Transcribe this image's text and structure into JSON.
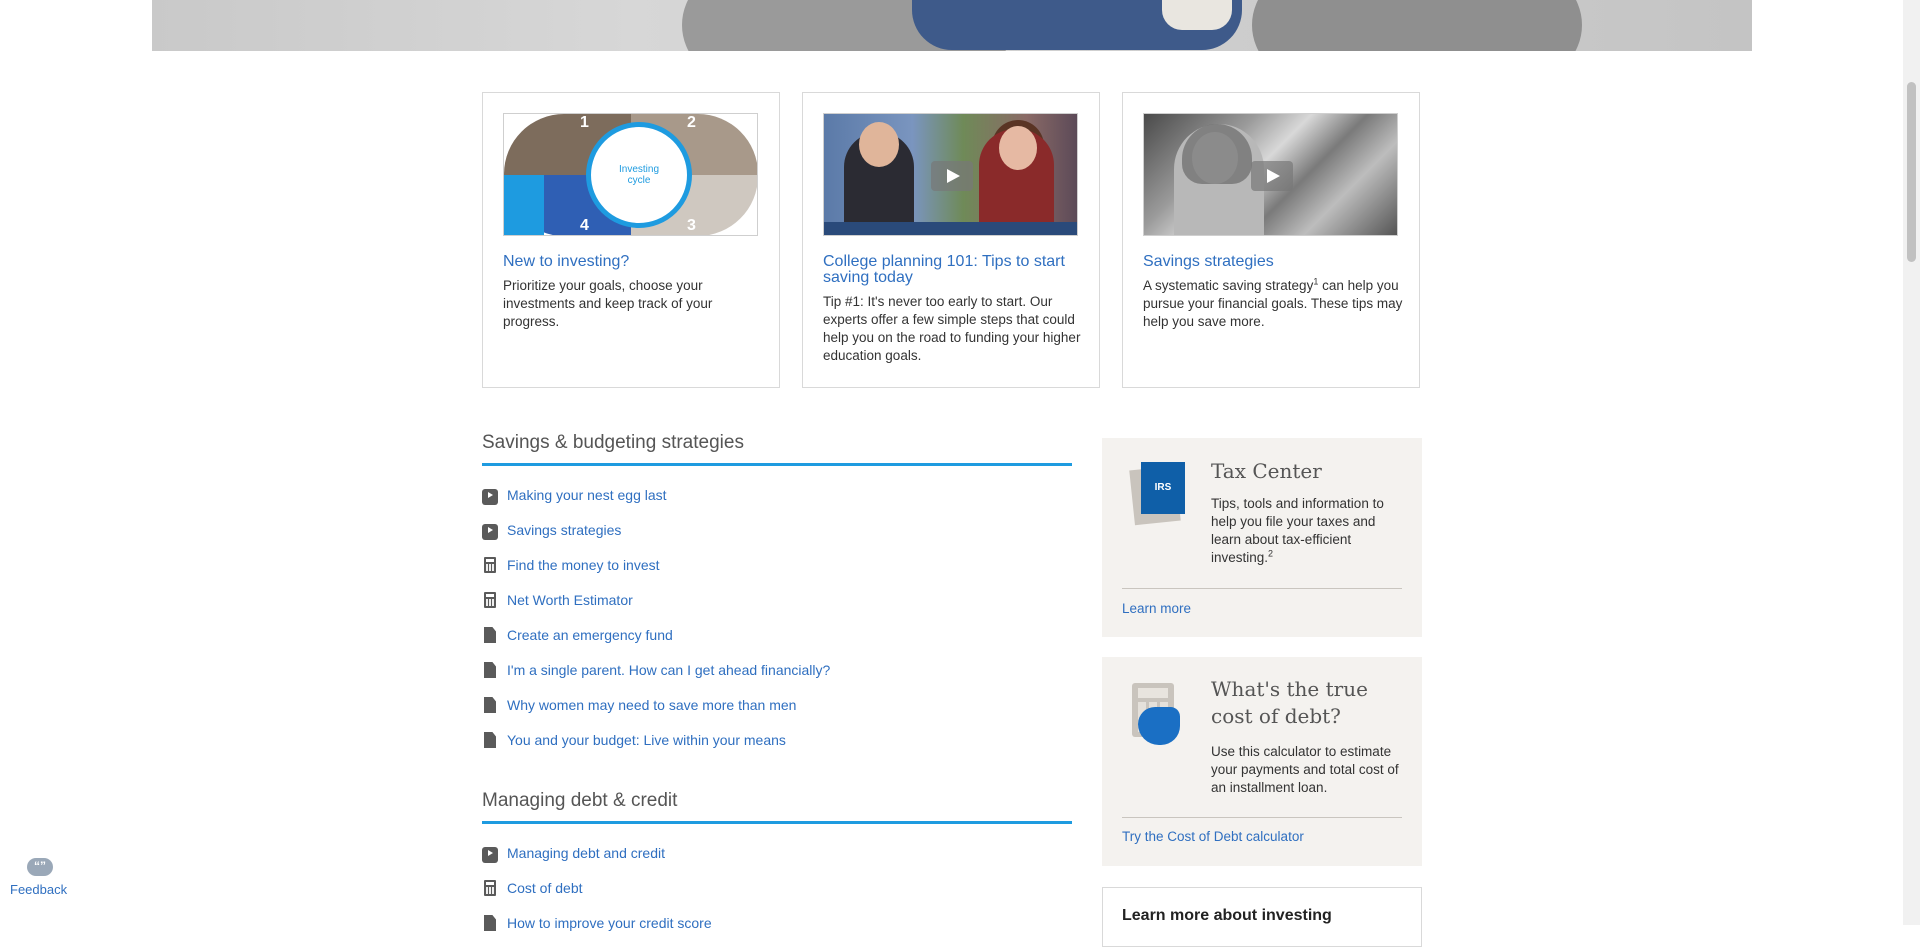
{
  "cards": [
    {
      "title": "New to investing?",
      "description": "Prioritize your goals, choose your investments and keep track of your progress.",
      "thumb_text": "Investing cycle",
      "thumb_numbers": [
        "1",
        "2",
        "3",
        "4"
      ]
    },
    {
      "title": "College planning 101: Tips to start saving today",
      "description": "Tip #1: It's never too early to start. Our experts offer a few simple steps that could help you on the road to funding your higher education goals."
    },
    {
      "title": "Savings strategies",
      "description_before": "A systematic saving strategy",
      "description_sup": "1",
      "description_after": " can help you pursue your financial goals. These tips may help you save more."
    }
  ],
  "sections": [
    {
      "title": "Savings & budgeting strategies",
      "items": [
        {
          "label": "Making your nest egg last",
          "icon": "video-icon"
        },
        {
          "label": "Savings strategies",
          "icon": "video-icon"
        },
        {
          "label": "Find the money to invest",
          "icon": "calculator-icon"
        },
        {
          "label": "Net Worth Estimator",
          "icon": "calculator-icon"
        },
        {
          "label": "Create an emergency fund",
          "icon": "document-icon"
        },
        {
          "label": "I'm a single parent. How can I get ahead financially?",
          "icon": "document-icon"
        },
        {
          "label": "Why women may need to save more than men",
          "icon": "document-icon"
        },
        {
          "label": "You and your budget: Live within your means",
          "icon": "document-icon"
        }
      ]
    },
    {
      "title": "Managing debt & credit",
      "items": [
        {
          "label": "Managing debt and credit",
          "icon": "video-icon"
        },
        {
          "label": "Cost of debt",
          "icon": "calculator-icon"
        },
        {
          "label": "How to improve your credit score",
          "icon": "document-icon"
        }
      ]
    }
  ],
  "side_cards": [
    {
      "title": "Tax Center",
      "icon_label": "IRS",
      "description": "Tips, tools and information to help you file your taxes and learn about tax-efficient investing.",
      "description_sup": "2",
      "link": "Learn more"
    },
    {
      "title": "What's the true cost of debt?",
      "description": "Use this calculator to estimate your payments and total cost of an installment loan.",
      "link": "Try the Cost of Debt calculator"
    },
    {
      "title": "Learn more about investing"
    }
  ],
  "feedback": {
    "label": "Feedback",
    "bubble": "“”"
  },
  "colors": {
    "link": "#2f6fc0",
    "accent_rule": "#1e9be0",
    "side_card_bg": "#f4f2ef"
  }
}
